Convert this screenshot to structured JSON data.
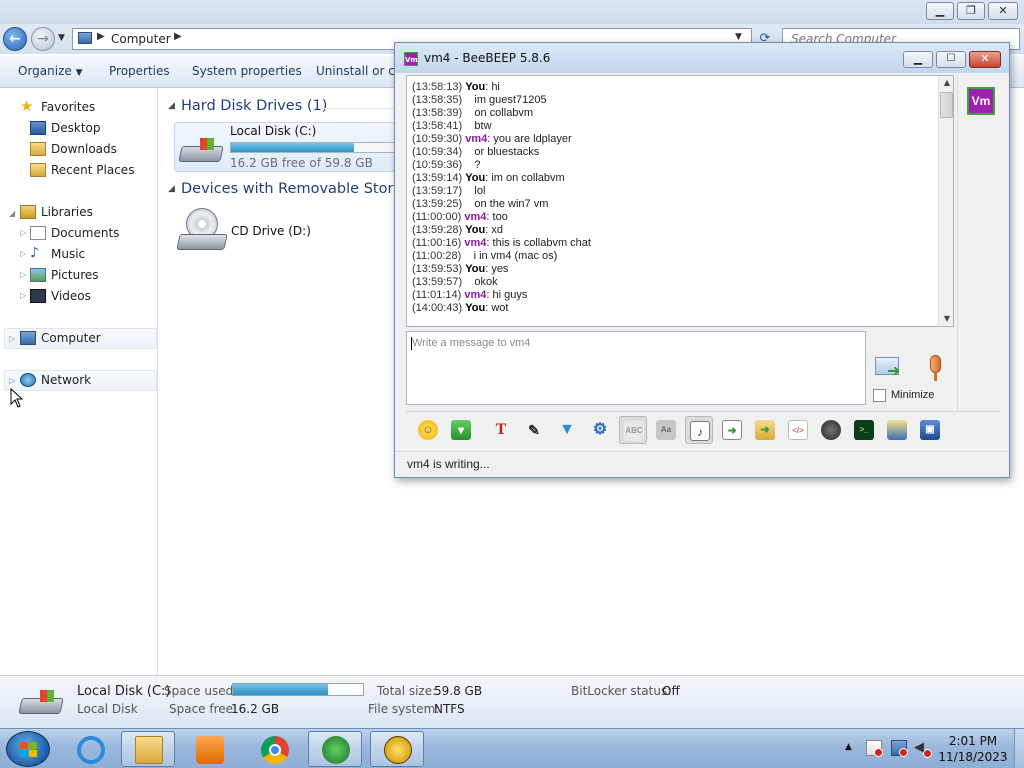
{
  "explorer": {
    "address": {
      "location": "Computer"
    },
    "search": {
      "placeholder": "Search Computer"
    },
    "toolbar": {
      "organize": "Organize",
      "properties": "Properties",
      "system_properties": "System properties",
      "uninstall": "Uninstall or cha"
    },
    "nav": {
      "favorites": "Favorites",
      "desktop": "Desktop",
      "downloads": "Downloads",
      "recent_places": "Recent Places",
      "libraries": "Libraries",
      "documents": "Documents",
      "music": "Music",
      "pictures": "Pictures",
      "videos": "Videos",
      "computer": "Computer",
      "network": "Network"
    },
    "content": {
      "hard_disk_header": "Hard Disk Drives (1)",
      "removable_header": "Devices with Removable Storage",
      "drive_c_name": "Local Disk (C:)",
      "drive_c_free": "16.2 GB free of 59.8 GB",
      "drive_c_used_fraction": 0.73,
      "cd_drive_name": "CD Drive (D:)"
    },
    "details": {
      "name": "Local Disk (C:)",
      "type": "Local Disk",
      "space_used_label": "Space used:",
      "space_free_label": "Space free:",
      "space_free": "16.2 GB",
      "total_size_label": "Total size:",
      "total_size": "59.8 GB",
      "file_system_label": "File system:",
      "file_system": "NTFS",
      "bitlocker_label": "BitLocker status:",
      "bitlocker": "Off"
    }
  },
  "beebeep": {
    "title": "vm4 - BeeBEEP 5.8.6",
    "user_avatar": "Vm",
    "input_placeholder": "Write a message to vm4",
    "minimize_label": "Minimize",
    "status": "vm4 is writing...",
    "messages": [
      {
        "time": "(13:58:13)",
        "sender": "You",
        "text": "hi"
      },
      {
        "time": "(13:58:35)",
        "sender": "",
        "text": "im guest71205"
      },
      {
        "time": "(13:58:39)",
        "sender": "",
        "text": "on collabvm"
      },
      {
        "time": "(13:58:41)",
        "sender": "",
        "text": "btw"
      },
      {
        "time": "(10:59:30)",
        "sender": "vm4",
        "text": "you are ldplayer"
      },
      {
        "time": "(10:59:34)",
        "sender": "",
        "text": "or bluestacks"
      },
      {
        "time": "(10:59:36)",
        "sender": "",
        "text": "?"
      },
      {
        "time": "(13:59:14)",
        "sender": "You",
        "text": "im on collabvm"
      },
      {
        "time": "(13:59:17)",
        "sender": "",
        "text": "lol"
      },
      {
        "time": "(13:59:25)",
        "sender": "",
        "text": "on the win7 vm"
      },
      {
        "time": "(11:00:00)",
        "sender": "vm4",
        "text": "too"
      },
      {
        "time": "(13:59:28)",
        "sender": "You",
        "text": "xd"
      },
      {
        "time": "(11:00:16)",
        "sender": "vm4",
        "text": "this is collabvm chat"
      },
      {
        "time": "(11:00:28)",
        "sender": "",
        "text": "i in vm4 (mac os)"
      },
      {
        "time": "(13:59:53)",
        "sender": "You",
        "text": "yes"
      },
      {
        "time": "(13:59:57)",
        "sender": "",
        "text": "okok"
      },
      {
        "time": "(11:01:14)",
        "sender": "vm4",
        "text": "hi guys"
      },
      {
        "time": "(14:00:43)",
        "sender": "You",
        "text": "wot"
      }
    ],
    "toolbar_icons": [
      "emoticons-icon",
      "save-chat-icon",
      "font-icon",
      "font-color-icon",
      "filter-icon",
      "settings-icon",
      "spellcheck-icon",
      "word-complete-icon",
      "sound-icon",
      "send-file-icon",
      "send-folder-icon",
      "html-icon",
      "screenshot-icon",
      "shell-icon",
      "notes-icon",
      "save-icon"
    ]
  },
  "taskbar": {
    "clock_time": "2:01 PM",
    "clock_date": "11/18/2023"
  }
}
